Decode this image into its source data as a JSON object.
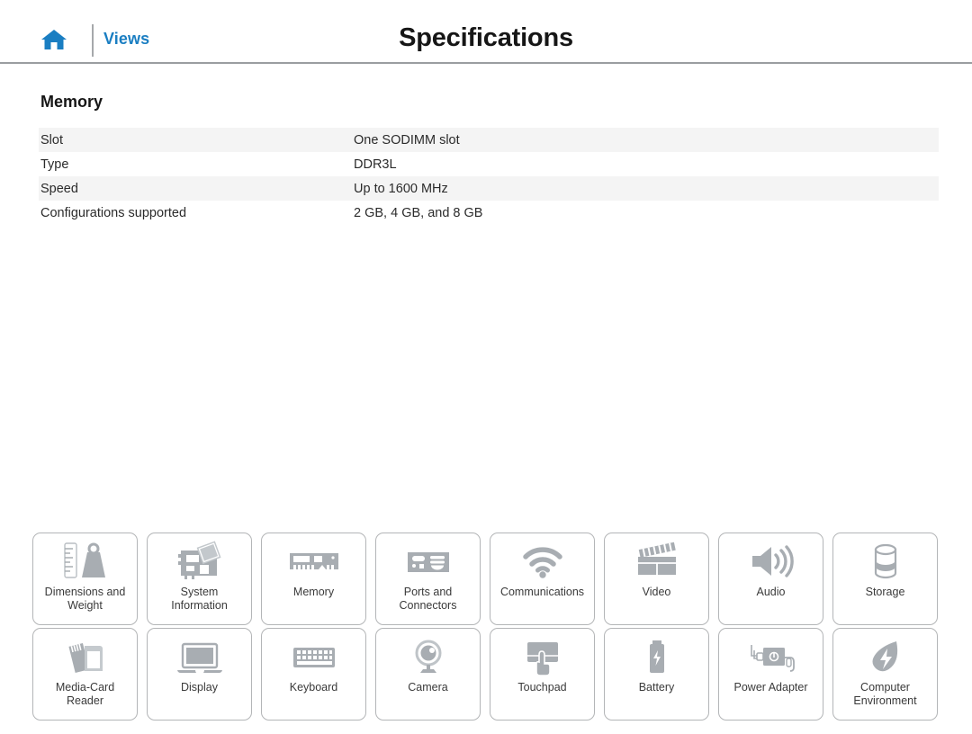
{
  "header": {
    "home_icon": "home-icon",
    "views_label": "Views",
    "title": "Specifications"
  },
  "section": {
    "heading": "Memory",
    "rows": [
      {
        "key": "Slot",
        "value": "One SODIMM slot"
      },
      {
        "key": "Type",
        "value": "DDR3L"
      },
      {
        "key": "Speed",
        "value": "Up to 1600 MHz"
      },
      {
        "key": "Configurations supported",
        "value": "2 GB, 4 GB, and 8 GB"
      }
    ]
  },
  "tiles": [
    {
      "label": "Dimensions and\nWeight",
      "icon": "ruler-weight-icon"
    },
    {
      "label": "System\nInformation",
      "icon": "motherboard-icon"
    },
    {
      "label": "Memory",
      "icon": "memory-module-icon"
    },
    {
      "label": "Ports and\nConnectors",
      "icon": "ports-icon"
    },
    {
      "label": "Communications",
      "icon": "wifi-icon"
    },
    {
      "label": "Video",
      "icon": "clapperboard-icon"
    },
    {
      "label": "Audio",
      "icon": "speaker-icon"
    },
    {
      "label": "Storage",
      "icon": "disk-cylinder-icon"
    },
    {
      "label": "Media-Card\nReader",
      "icon": "media-card-icon"
    },
    {
      "label": "Display",
      "icon": "laptop-screen-icon"
    },
    {
      "label": "Keyboard",
      "icon": "keyboard-icon"
    },
    {
      "label": "Camera",
      "icon": "webcam-icon"
    },
    {
      "label": "Touchpad",
      "icon": "touchpad-hand-icon"
    },
    {
      "label": "Battery",
      "icon": "battery-icon"
    },
    {
      "label": "Power Adapter",
      "icon": "power-adapter-icon"
    },
    {
      "label": "Computer\nEnvironment",
      "icon": "leaf-bolt-icon"
    }
  ],
  "colors": {
    "accent_blue": "#1a7ec2",
    "icon_gray": "#a8adb2",
    "rule_gray": "#9a9da0",
    "tile_border": "#b3b5b7",
    "stripe": "#f4f4f4"
  }
}
